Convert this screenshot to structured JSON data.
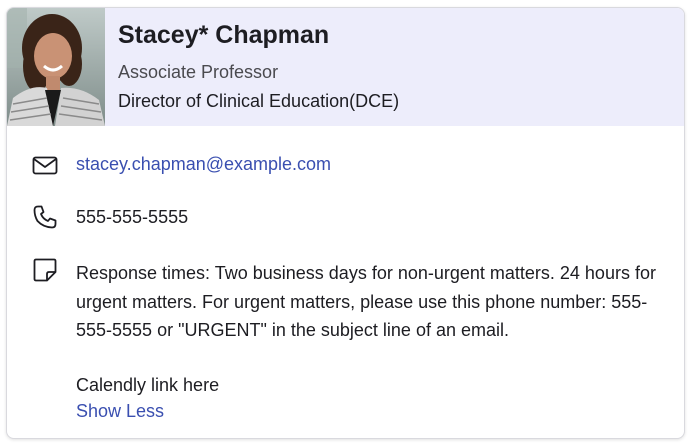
{
  "profile": {
    "name": "Stacey* Chapman",
    "title": "Associate Professor",
    "role": "Director of Clinical Education(DCE)",
    "photo_alt": "Stacey Chapman profile photo"
  },
  "contact": {
    "email": "stacey.chapman@example.com",
    "phone": "555-555-5555",
    "note": "Response times: Two business days for non-urgent matters. 24 hours for urgent matters. For urgent matters, please use this phone number: 555-555-5555 or \"URGENT\" in the subject line of an email.",
    "calendly": "Calendly link here",
    "toggle_label": "Show Less"
  },
  "icons": {
    "email": "envelope-icon",
    "phone": "phone-icon",
    "note": "sticky-note-icon"
  },
  "colors": {
    "header_bg": "#ededfb",
    "link": "#3a4fb0",
    "text": "#1d1d22",
    "muted": "#4a4a4f"
  }
}
